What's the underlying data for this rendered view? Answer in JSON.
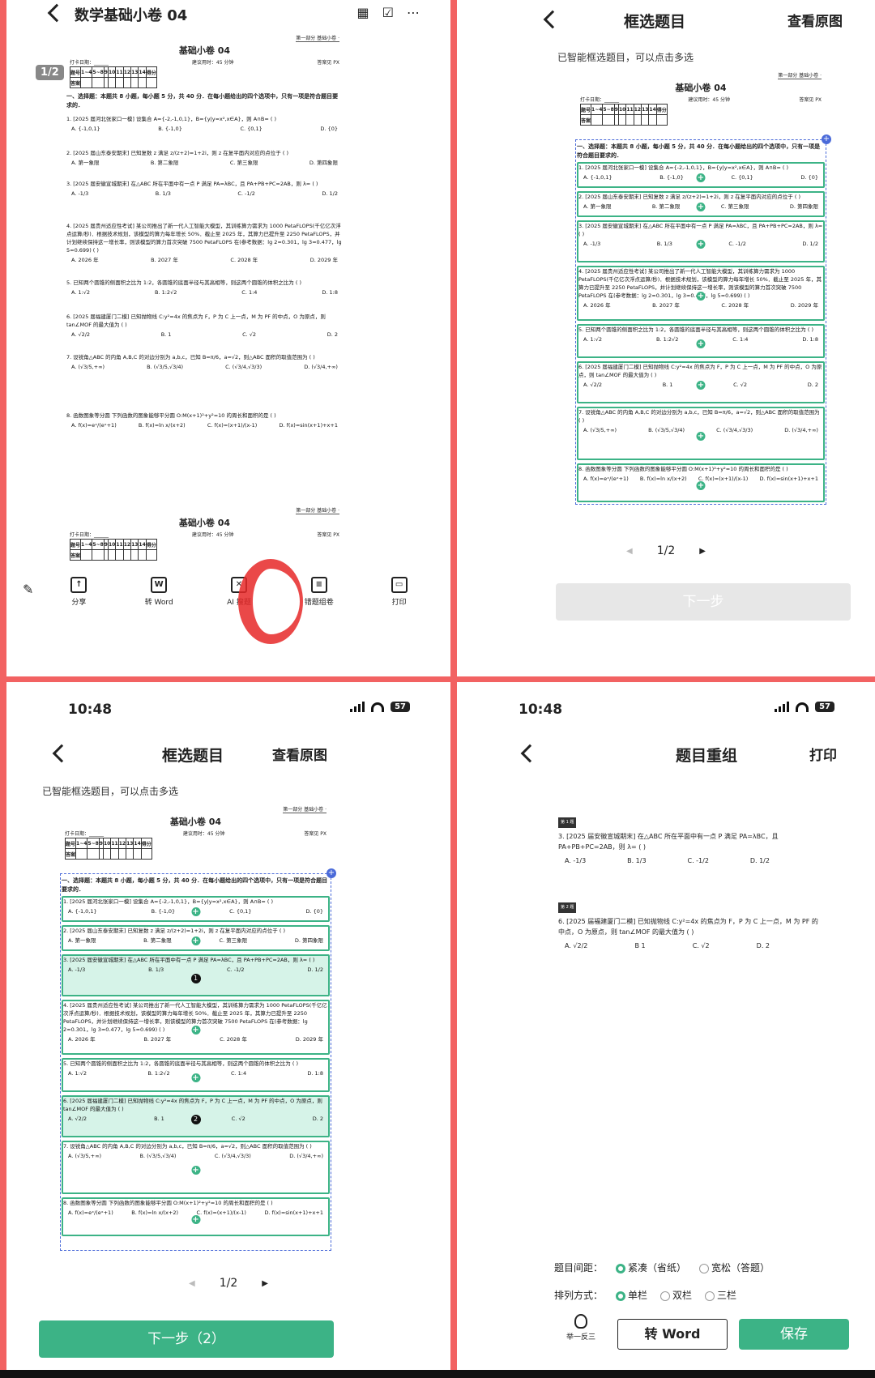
{
  "panel1": {
    "title": "数学基础小卷 04",
    "page_chip": "1/2",
    "icons": [
      "grid-icon",
      "check-square-icon",
      "more-icon"
    ],
    "toolbar": [
      {
        "label": "分享",
        "icon": "share-icon"
      },
      {
        "label": "转 Word",
        "icon": "word-icon"
      },
      {
        "label": "AI 搜题",
        "icon": "ai-search-icon"
      },
      {
        "label": "错题组卷",
        "icon": "compose-icon"
      },
      {
        "label": "打印",
        "icon": "print-icon"
      }
    ]
  },
  "paper": {
    "part": "第一部分  基础小卷 ·",
    "title": "基础小卷 04",
    "title_p1": "基础小卷 04",
    "meta_left": "打卡日期：______",
    "meta_mid": "建议用时：45 分钟",
    "meta_right": "答案见 PX",
    "table_head": [
      "题号",
      "1~4",
      "5~8",
      "9",
      "10",
      "11",
      "12",
      "13",
      "14",
      "得分"
    ],
    "table_row": "答案",
    "section": "一、选择题：本题共 8 小题，每小题 5 分，共 40 分．在每小题给出的四个选项中，只有一项是符合题目要求的．",
    "questions": [
      {
        "stem": "1. [2025 届河北张家口一模] 设集合 A={-2,-1,0,1}，B={y|y=x²,x∈A}，则 A∩B=   (   )",
        "opts": [
          "A. {-1,0,1}",
          "B. {-1,0}",
          "C. {0,1}",
          "D. {0}"
        ]
      },
      {
        "stem": "2. [2025 届山东泰安期末] 已知复数 z 满足 z/(z+2)=1+2i，则 z 在复平面内对应的点位于   (   )",
        "opts": [
          "A. 第一象限",
          "B. 第二象限",
          "C. 第三象限",
          "D. 第四象限"
        ]
      },
      {
        "stem": "3. [2025 届安徽宣城期末] 在△ABC 所在平面中有一点 P 满足 PA=λBC，且 PA+PB+PC=2AB，则 λ=   (   )",
        "opts": [
          "A. -1/3",
          "B. 1/3",
          "C. -1/2",
          "D. 1/2"
        ]
      },
      {
        "stem": "4. [2025 届贵州适应性考试] 某公司推出了新一代人工智能大模型，其训练算力需求为 1000 PetaFLOPS(千亿亿次浮点运算/秒)．根据技术规划，该模型的算力每年增长 50%．截止至 2025 年，其算力已提升至 2250 PetaFLOPS，并计划继续保持这一增长率，则该模型的算力首次突破 7500 PetaFLOPS 在(参考数据：lg 2≈0.301，lg 3≈0.477，lg 5≈0.699)   (   )",
        "opts": [
          "A. 2026 年",
          "B. 2027 年",
          "C. 2028 年",
          "D. 2029 年"
        ]
      },
      {
        "stem": "5. 已知两个圆锥的侧面积之比为 1:2，各圆锥的底面半径与其高相等，则这两个圆锥的体积之比为   (   )",
        "opts": [
          "A. 1:√2",
          "B. 1:2√2",
          "C. 1:4",
          "D. 1:8"
        ]
      },
      {
        "stem": "6. [2025 届福建厦门二模] 已知抛物线 C:y²=4x 的焦点为 F，P 为 C 上一点，M 为 PF 的中点，O 为原点，则 tan∠MOF 的最大值为   (   )",
        "opts": [
          "A. √2/2",
          "B. 1",
          "C. √2",
          "D. 2"
        ]
      },
      {
        "stem": "7. 设锐角△ABC 的内角 A,B,C 的对边分别为 a,b,c，已知 B=π/6，a=√2，则△ABC 面积的取值范围为   (   )",
        "opts": [
          "A. (√3/5,+∞)",
          "B. (√3/5,√3/4)",
          "C. (√3/4,√3/3)",
          "D. (√3/4,+∞)"
        ]
      },
      {
        "stem": "8. 函数图象等分圆  下列函数的图象能够平分圆 O:M(x+1)²+y²=10 的周长和面积的是   (   )",
        "opts": [
          "A. f(x)=eˣ/(eˣ+1)",
          "B. f(x)=ln x/(x+2)",
          "C. f(x)=(x+1)/(x-1)",
          "D. f(x)=sin(x+1)+x+1"
        ]
      }
    ]
  },
  "panel2": {
    "title": "框选题目",
    "right_link": "查看原图",
    "hint": "已智能框选题目，可以点击多选",
    "pager": "1/2",
    "next_button": "下一步"
  },
  "panel3": {
    "time": "10:48",
    "battery": "57",
    "title": "框选题目",
    "right_link": "查看原图",
    "hint": "已智能框选题目，可以点击多选",
    "pager": "1/2",
    "next_button": "下一步（2）",
    "selected": [
      "1",
      "2"
    ]
  },
  "panel4": {
    "time": "10:48",
    "battery": "57",
    "title": "题目重组",
    "right_link": "打印",
    "q1_label": "第 1 题",
    "q1_stem": "3. [2025 届安徽宣城期末] 在△ABC 所在平面中有一点 P 满足 PA=λBC，且 PA+PB+PC=2AB，则 λ=   (   )",
    "q1_opts": [
      "A. -1/3",
      "B. 1/3",
      "C. -1/2",
      "D. 1/2"
    ],
    "q2_label": "第 2 题",
    "q2_stem": "6. [2025 届福建厦门二模] 已知抛物线 C:y²=4x 的焦点为 F，P 为 C 上一点，M 为 PF 的中点，O 为原点，则 tan∠MOF 的最大值为   (   )",
    "q2_opts": [
      "A. √2/2",
      "B 1",
      "C. √2",
      "D. 2"
    ],
    "spacing_label": "题目间距：",
    "spacing_opts": [
      "紧凑（省纸）",
      "宽松（答题）"
    ],
    "layout_label": "排列方式：",
    "layout_opts": [
      "单栏",
      "双栏",
      "三栏"
    ],
    "bulb_label": "举一反三",
    "word_button": "转 Word",
    "save_button": "保存"
  }
}
